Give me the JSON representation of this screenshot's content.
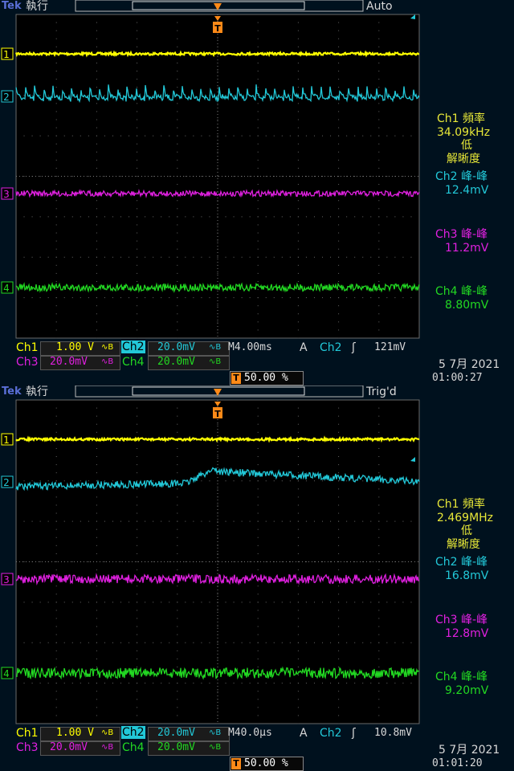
{
  "screens": [
    {
      "brand": "Tek",
      "run_state": "執行",
      "trigger_status": "Auto",
      "trigger_marker": "T",
      "ch_labels": [
        "1",
        "2",
        "3",
        "4"
      ],
      "meas": {
        "ch1_title": "Ch1 頻率",
        "ch1_value": "34.09kHz",
        "ch1_note1": "低",
        "ch1_note2": "解晰度",
        "ch2_title": "Ch2 峰-峰",
        "ch2_value": "12.4mV",
        "ch3_title": "Ch3 峰-峰",
        "ch3_value": "11.2mV",
        "ch4_title": "Ch4 峰-峰",
        "ch4_value": "8.80mV"
      },
      "status": {
        "ch1": "Ch1",
        "ch1_scale": "1.00 V",
        "ch2": "Ch2",
        "ch2_scale": "20.0mV",
        "ch3": "Ch3",
        "ch3_scale": "20.0mV",
        "ch4": "Ch4",
        "ch4_scale": "20.0mV",
        "bw": "∿B",
        "timebase": "M4.00ms",
        "coupling": "A",
        "trig_src": "Ch2",
        "trig_slope": "ʃ",
        "trig_level": "121mV",
        "trig_pos": "50.00 %",
        "date": "5 7月  2021",
        "time": "01:00:27"
      },
      "colors": {
        "ch1": "#ffff00",
        "ch2": "#22c8d8",
        "ch3": "#e020e0",
        "ch4": "#22d822"
      }
    },
    {
      "brand": "Tek",
      "run_state": "執行",
      "trigger_status": "Trig'd",
      "trigger_marker": "T",
      "ch_labels": [
        "1",
        "2",
        "3",
        "4"
      ],
      "meas": {
        "ch1_title": "Ch1 頻率",
        "ch1_value": "2.469MHz",
        "ch1_note1": "低",
        "ch1_note2": "解晰度",
        "ch2_title": "Ch2 峰-峰",
        "ch2_value": "16.8mV",
        "ch3_title": "Ch3 峰-峰",
        "ch3_value": "12.8mV",
        "ch4_title": "Ch4 峰-峰",
        "ch4_value": "9.20mV"
      },
      "status": {
        "ch1": "Ch1",
        "ch1_scale": "1.00 V",
        "ch2": "Ch2",
        "ch2_scale": "20.0mV",
        "ch3": "Ch3",
        "ch3_scale": "20.0mV",
        "ch4": "Ch4",
        "ch4_scale": "20.0mV",
        "bw": "∿B",
        "timebase": "M40.0µs",
        "coupling": "A",
        "trig_src": "Ch2",
        "trig_slope": "ʃ",
        "trig_level": "10.8mV",
        "trig_pos": "50.00 %",
        "date": "5 7月  2021",
        "time": "01:01:20"
      },
      "colors": {
        "ch1": "#ffff00",
        "ch2": "#22c8d8",
        "ch3": "#e020e0",
        "ch4": "#22d822"
      }
    }
  ]
}
